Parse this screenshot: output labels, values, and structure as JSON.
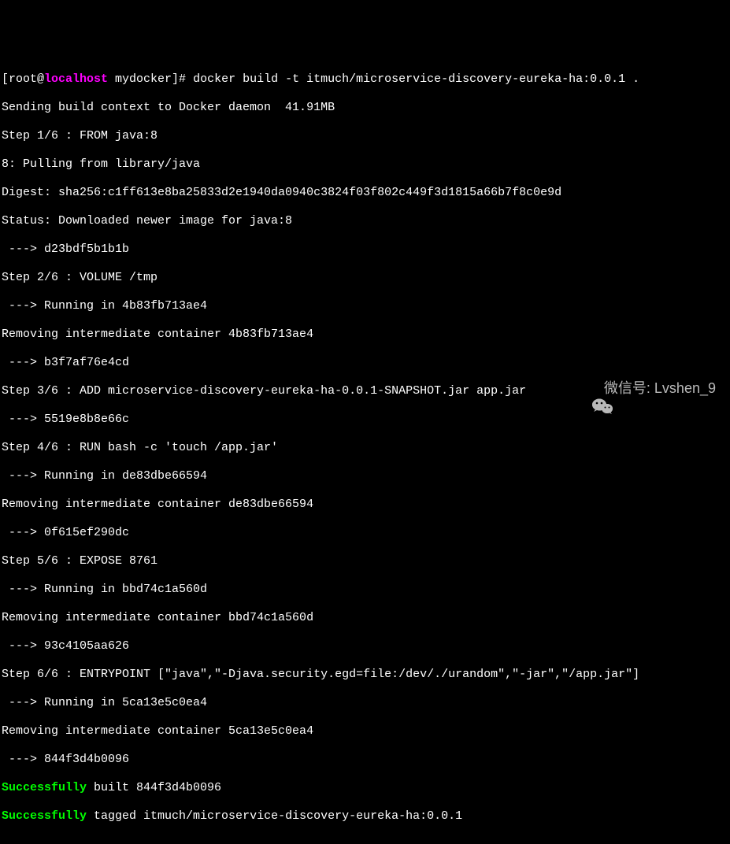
{
  "prompt": {
    "user_host_prefix": "[root@",
    "hostname": "localhost",
    "path_suffix": " mydocker]# ",
    "command": "docker build -t itmuch/microservice-discovery-eureka-ha:0.0.1 ."
  },
  "lines": {
    "l1": "Sending build context to Docker daemon  41.91MB",
    "l2": "Step 1/6 : FROM java:8",
    "l3": "8: Pulling from library/java",
    "l4": "Digest: sha256:c1ff613e8ba25833d2e1940da0940c3824f03f802c449f3d1815a66b7f8c0e9d",
    "l5": "Status: Downloaded newer image for java:8",
    "l6": " ---> d23bdf5b1b1b",
    "l7": "Step 2/6 : VOLUME /tmp",
    "l8": " ---> Running in 4b83fb713ae4",
    "l9": "Removing intermediate container 4b83fb713ae4",
    "l10": " ---> b3f7af76e4cd",
    "l11": "Step 3/6 : ADD microservice-discovery-eureka-ha-0.0.1-SNAPSHOT.jar app.jar",
    "l12": " ---> 5519e8b8e66c",
    "l13": "Step 4/6 : RUN bash -c 'touch /app.jar'",
    "l14": " ---> Running in de83dbe66594",
    "l15": "Removing intermediate container de83dbe66594",
    "l16": " ---> 0f615ef290dc",
    "l17": "Step 5/6 : EXPOSE 8761",
    "l18": " ---> Running in bbd74c1a560d",
    "l19": "Removing intermediate container bbd74c1a560d",
    "l20": " ---> 93c4105aa626",
    "l21": "Step 6/6 : ENTRYPOINT [\"java\",\"-Djava.security.egd=file:/dev/./urandom\",\"-jar\",\"/app.jar\"]",
    "l22": " ---> Running in 5ca13e5c0ea4",
    "l23": "Removing intermediate container 5ca13e5c0ea4",
    "l24": " ---> 844f3d4b0096",
    "l25a": "Successfully",
    "l25b": " built 844f3d4b0096",
    "l26a": "Successfully",
    "l26b": " tagged itmuch/microservice-discovery-eureka-ha:0.0.1"
  },
  "watermark": {
    "label": "微信号: Lvshen_9"
  }
}
